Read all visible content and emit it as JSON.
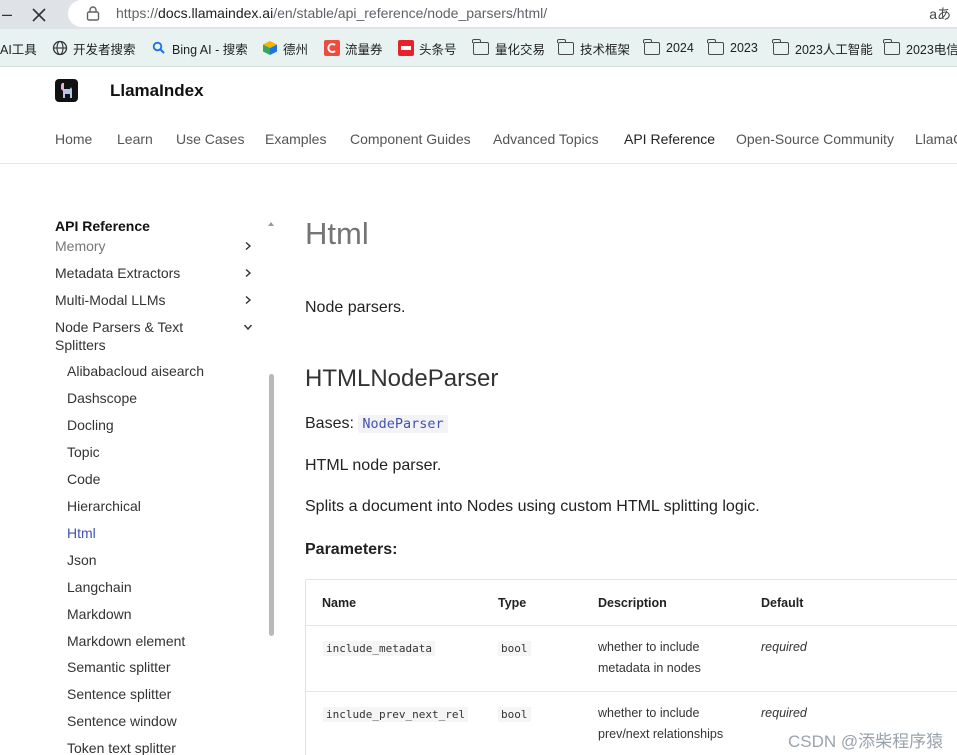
{
  "browser": {
    "url_prefix": "https://",
    "url_host": "docs.llamaindex.ai",
    "url_path": "/en/stable/api_reference/node_parsers/html/",
    "reader_label": "aあ",
    "bookmarks": [
      {
        "label": "AI工具",
        "icon": "none"
      },
      {
        "label": "开发者搜索",
        "icon": "globe-icon"
      },
      {
        "label": "Bing AI - 搜索",
        "icon": "search-icon"
      },
      {
        "label": "德州",
        "icon": "cube-icon"
      },
      {
        "label": "流量券",
        "icon": "c-icon"
      },
      {
        "label": "头条号",
        "icon": "toutiao-icon"
      },
      {
        "label": "量化交易",
        "icon": "folder-icon"
      },
      {
        "label": "技术框架",
        "icon": "folder-icon"
      },
      {
        "label": "2024",
        "icon": "folder-icon"
      },
      {
        "label": "2023",
        "icon": "folder-icon"
      },
      {
        "label": "2023人工智能",
        "icon": "folder-icon"
      },
      {
        "label": "2023电信",
        "icon": "folder-icon"
      }
    ]
  },
  "site": {
    "brand": "LlamaIndex",
    "tabs": [
      "Home",
      "Learn",
      "Use Cases",
      "Examples",
      "Component Guides",
      "Advanced Topics",
      "API Reference",
      "Open-Source Community",
      "LlamaC"
    ],
    "active_tab": "API Reference"
  },
  "sidebar": {
    "title": "API Reference",
    "items": [
      {
        "label": "Memory",
        "chevron": "right"
      },
      {
        "label": "Metadata Extractors",
        "chevron": "right"
      },
      {
        "label": "Multi-Modal LLMs",
        "chevron": "right"
      },
      {
        "label": "Node Parsers & Text Splitters",
        "chevron": "down"
      }
    ],
    "sub_items": [
      "Alibabacloud aisearch",
      "Dashscope",
      "Docling",
      "Topic",
      "Code",
      "Hierarchical",
      "Html",
      "Json",
      "Langchain",
      "Markdown",
      "Markdown element",
      "Semantic splitter",
      "Sentence splitter",
      "Sentence window",
      "Token text splitter"
    ],
    "active_sub": "Html"
  },
  "content": {
    "title": "Html",
    "intro": "Node parsers.",
    "class_name": "HTMLNodeParser",
    "bases_label": "Bases:",
    "bases_value": "NodeParser",
    "description": "HTML node parser.",
    "detail": "Splits a document into Nodes using custom HTML splitting logic.",
    "parameters_label": "Parameters:",
    "table": {
      "headers": [
        "Name",
        "Type",
        "Description",
        "Default"
      ],
      "rows": [
        {
          "name": "include_metadata",
          "type": "bool",
          "desc1": "whether to include",
          "desc2": "metadata in nodes",
          "default": "required"
        },
        {
          "name": "include_prev_next_rel",
          "type": "bool",
          "desc1": "whether to include",
          "desc2": "prev/next relationships",
          "default": "required"
        }
      ]
    }
  },
  "watermark": "CSDN @添柴程序猿",
  "colors": {
    "accent": "#4051b5",
    "bookmark_bar": "#e7f2f1",
    "chrome": "#dfe3e8"
  }
}
